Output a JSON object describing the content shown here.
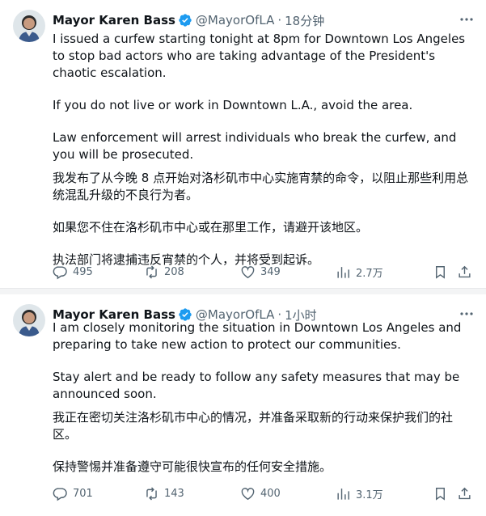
{
  "tweets": [
    {
      "author": {
        "name": "Mayor Karen Bass",
        "handle": "@MayorOfLA",
        "time": "18分钟"
      },
      "en": [
        "I issued a curfew starting tonight at 8pm for Downtown Los Angeles to stop bad actors who are taking advantage of the President's chaotic escalation.",
        "If you do not live or work in Downtown L.A., avoid the area.",
        "Law enforcement will arrest individuals who break the curfew, and you will be prosecuted."
      ],
      "zh": [
        "我发布了从今晚 8 点开始对洛杉矶市中心实施宵禁的命令，以阻止那些利用总统混乱升级的不良行为者。",
        "如果您不住在洛杉矶市中心或在那里工作，请避开该地区。",
        "执法部门将逮捕违反宵禁的个人，并将受到起诉。"
      ],
      "stats": {
        "replies": "495",
        "reposts": "208",
        "likes": "349",
        "views": "2.7万"
      }
    },
    {
      "author": {
        "name": "Mayor Karen Bass",
        "handle": "@MayorOfLA",
        "time": "1小时"
      },
      "en": [
        "I am closely monitoring the situation in Downtown Los Angeles and preparing to take new action to protect our communities.",
        "Stay alert and be ready to follow any safety measures that may be announced soon."
      ],
      "zh": [
        "我正在密切关注洛杉矶市中心的情况，并准备采取新的行动来保护我们的社区。",
        "保持警惕并准备遵守可能很快宣布的任何安全措施。"
      ],
      "stats": {
        "replies": "701",
        "reposts": "143",
        "likes": "400",
        "views": "3.1万"
      }
    }
  ],
  "icons": {
    "reply": "reply-icon",
    "repost": "repost-icon",
    "like": "like-icon",
    "views": "views-icon",
    "bookmark": "bookmark-icon",
    "share": "share-icon",
    "more": "more-icon",
    "verified": "verified-badge-icon"
  },
  "colors": {
    "text": "#0f1419",
    "muted": "#536471",
    "verified": "#1d9bf0"
  }
}
